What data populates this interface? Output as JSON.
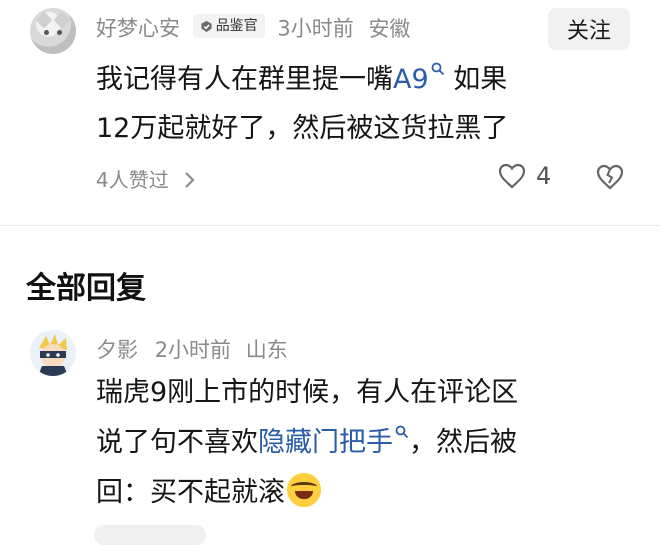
{
  "comment": {
    "username": "好梦心安",
    "badge": "品鉴官",
    "time": "3小时前",
    "location": "安徽",
    "follow_label": "关注",
    "text_line1_before": "我记得有人在群里提一嘴",
    "text_link": "A9",
    "text_line1_after": " 如果",
    "text_line2": "12万起就好了，然后被这货拉黑了",
    "likes_link": "4人赞过",
    "like_count": "4"
  },
  "section_title": "全部回复",
  "reply": {
    "username": "夕影",
    "time": "2小时前",
    "location": "山东",
    "text_line1": "瑞虎9刚上市的时候，有人在评论区",
    "text_line2_before": "说了句不喜欢",
    "text_link": "隐藏门把手",
    "text_line2_after": "，然后被",
    "text_line3": "回：买不起就滚"
  },
  "icons": {
    "search": "search-icon",
    "chevron": "chevron-right-icon",
    "like": "heart-icon",
    "dislike": "broken-heart-icon",
    "badge": "verified-badge-icon",
    "emoji": "laughing-crying-emoji-icon"
  },
  "colors": {
    "link": "#2a5ca8",
    "meta": "#8a8a8a"
  }
}
